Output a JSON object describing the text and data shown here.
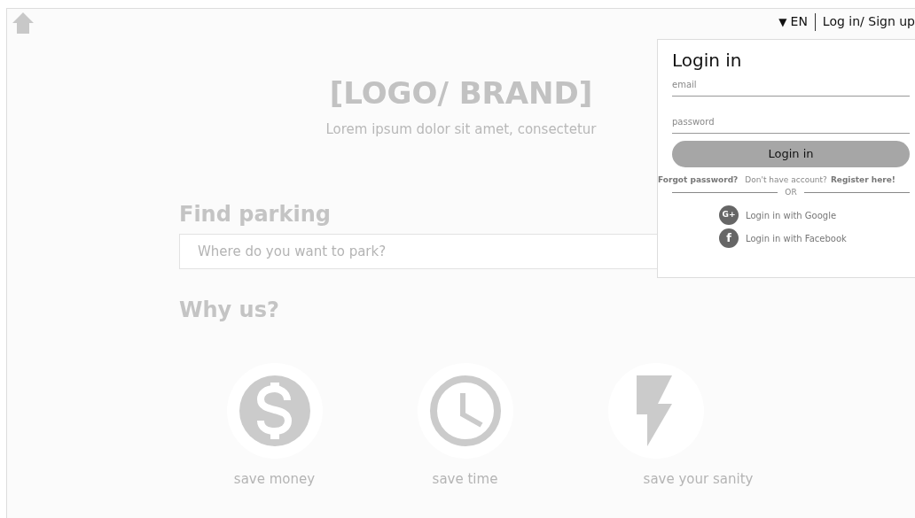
{
  "header": {
    "language": "EN",
    "language_caret": "▼",
    "auth_link": "Log in/ Sign up"
  },
  "hero": {
    "logo": "[LOGO/ BRAND]",
    "tagline": "Lorem ipsum dolor sit amet, consectetur"
  },
  "search": {
    "heading": "Find parking",
    "placeholder": "Where do you want to park?"
  },
  "why": {
    "heading": "Why us?",
    "features": [
      {
        "kind": "money",
        "label": "save money"
      },
      {
        "kind": "time",
        "label": "save time"
      },
      {
        "kind": "bolt",
        "label": "save your sanity"
      }
    ]
  },
  "login_popup": {
    "title": "Login in",
    "email_placeholder": "email",
    "password_placeholder": "password",
    "button": "Login in",
    "forgot": "Forgot password?",
    "no_account": "Don't have account?",
    "register": "Register here!",
    "divider": "OR",
    "social": [
      {
        "kind": "google",
        "glyph": "G+",
        "label": "Login in with Google"
      },
      {
        "kind": "facebook",
        "glyph": "f",
        "label": "Login in with Facebook"
      }
    ]
  }
}
